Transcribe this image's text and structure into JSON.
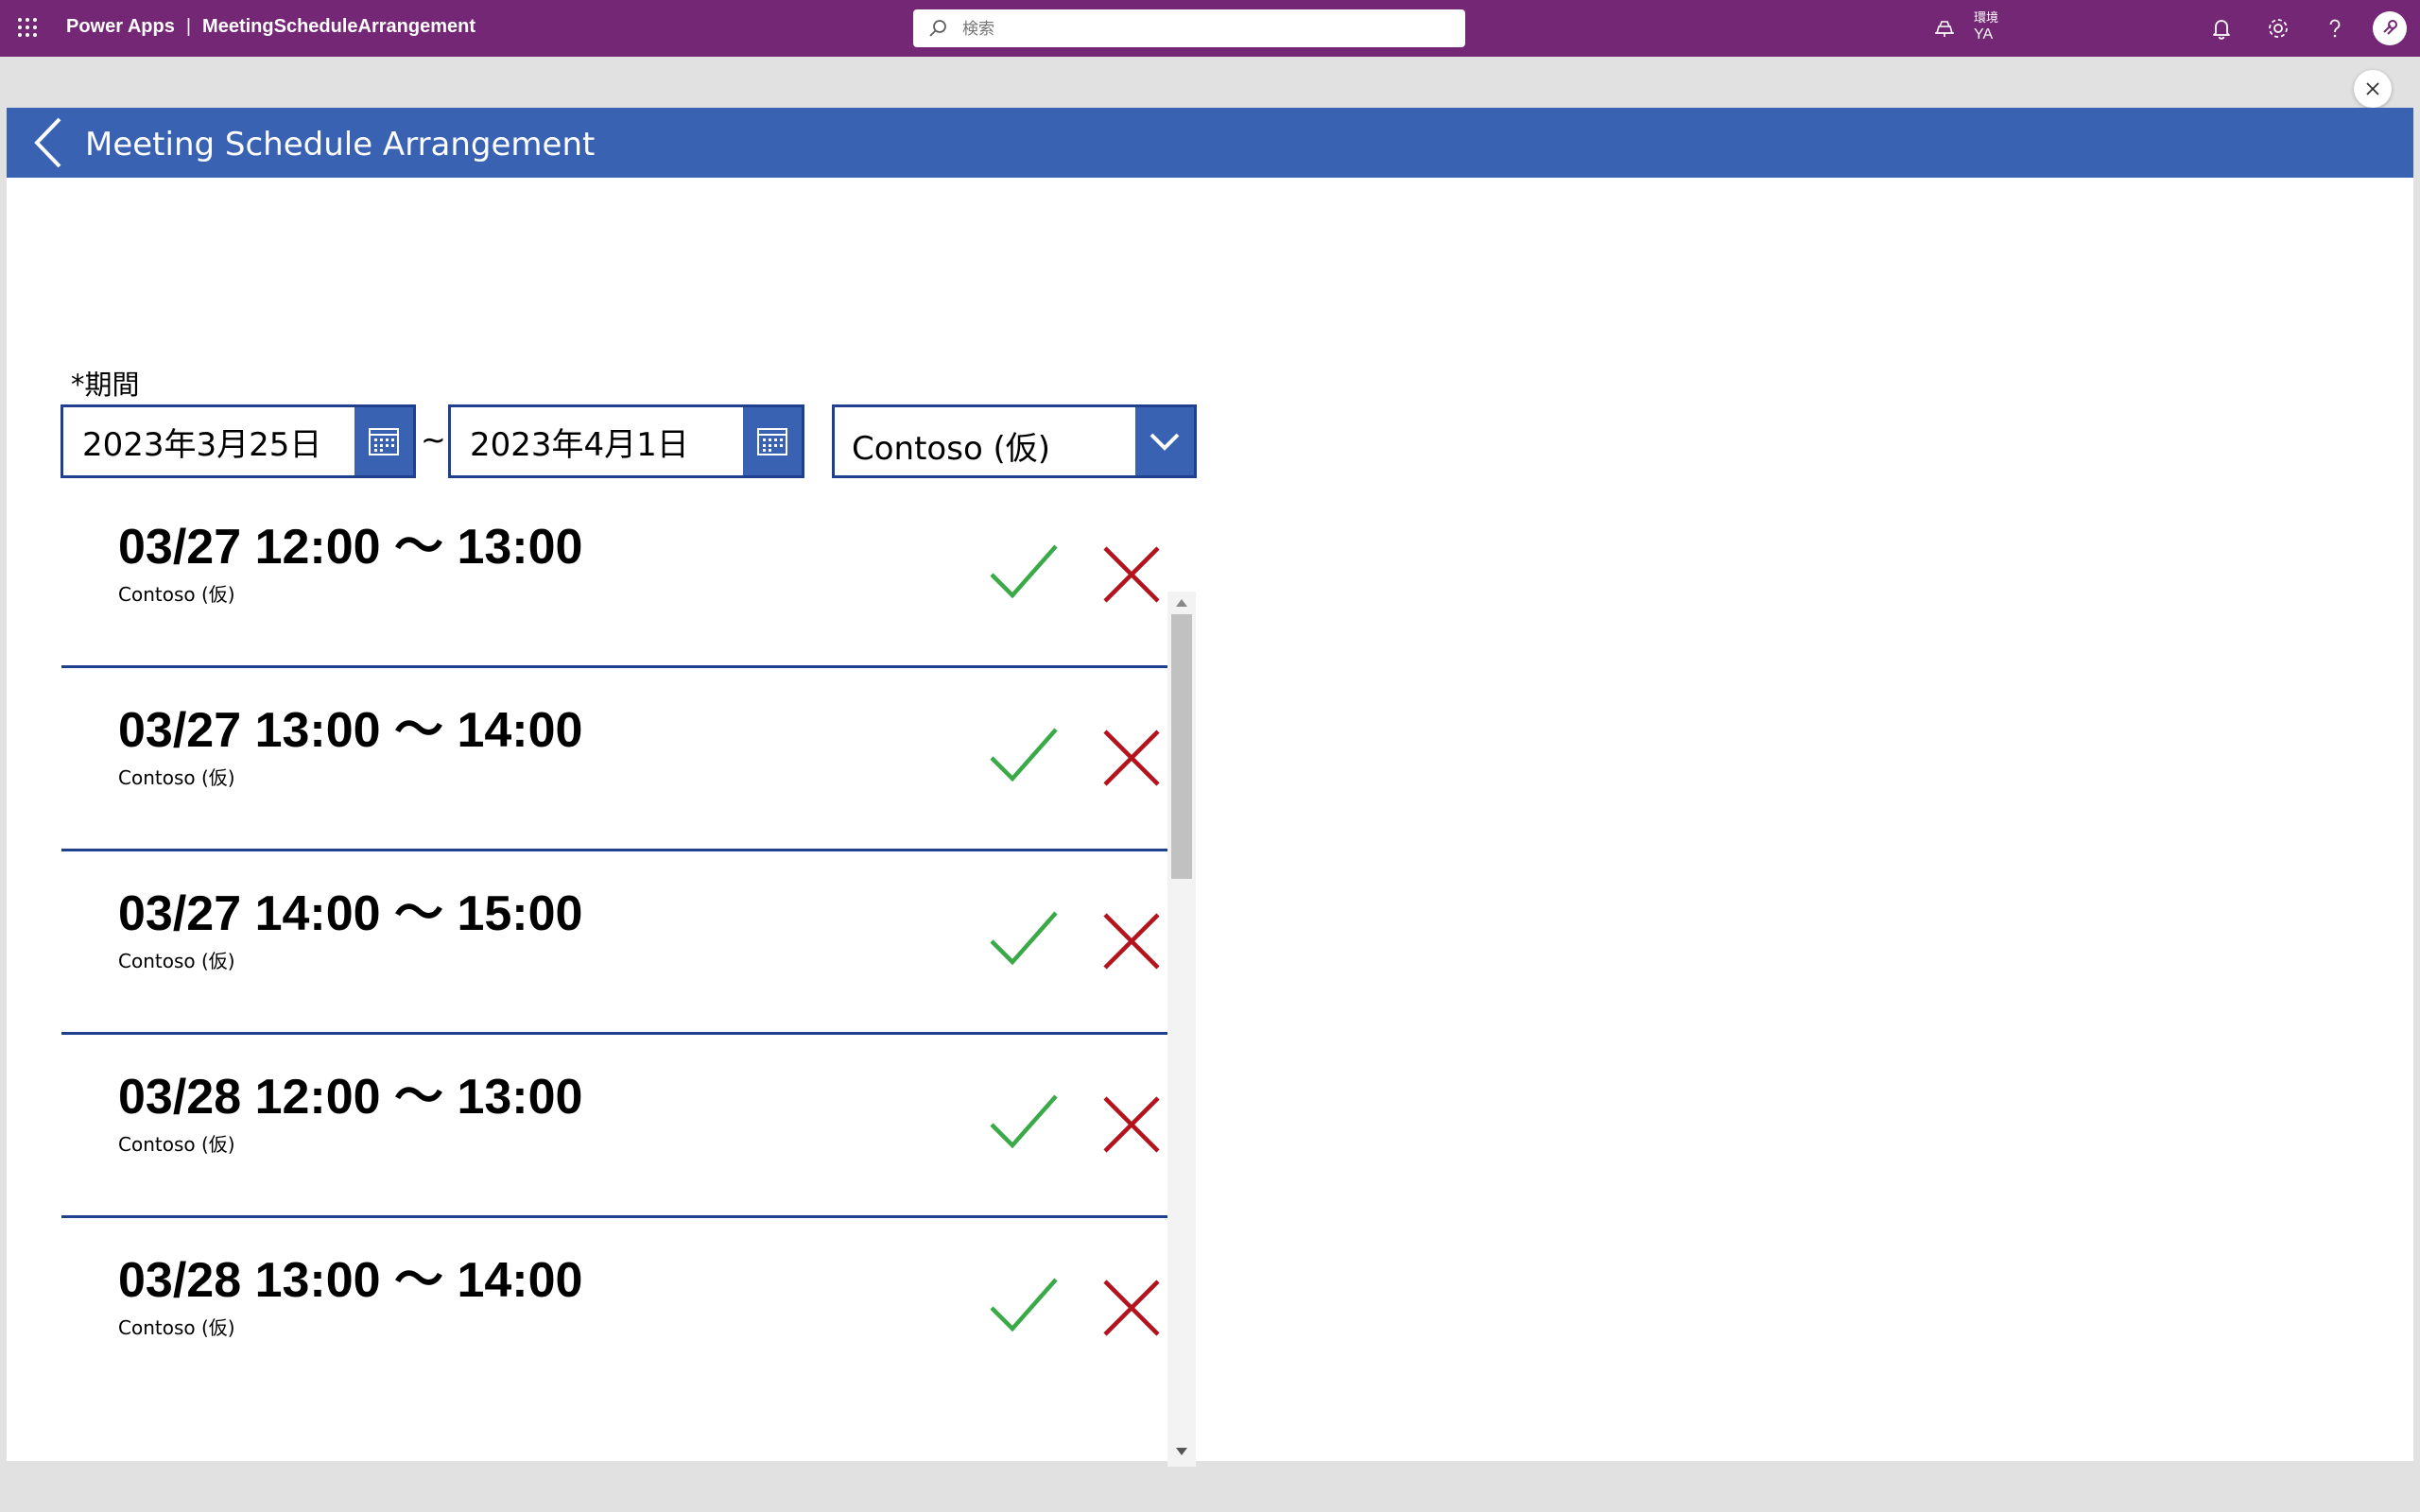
{
  "topbar": {
    "product": "Power Apps",
    "separator": "|",
    "app_name": "MeetingScheduleArrangement",
    "search_placeholder": "検索",
    "environment_label": "環境",
    "environment_name": "YA",
    "icons": [
      "waffle-icon",
      "search-icon",
      "environment-icon",
      "bell-icon",
      "gear-icon",
      "help-icon",
      "avatar-icon"
    ],
    "background_color": "#742774"
  },
  "app": {
    "title": "Meeting Schedule Arrangement",
    "header_color": "#3a62b3",
    "period_label": "*期間",
    "start_date": "2023年3月25日",
    "range_separator": "~",
    "end_date": "2023年4月1日",
    "company_filter": "Contoso (仮)"
  },
  "slots": [
    {
      "time": "03/27 12:00 〜 13:00",
      "org": "Contoso (仮)"
    },
    {
      "time": "03/27 13:00 〜 14:00",
      "org": "Contoso (仮)"
    },
    {
      "time": "03/27 14:00 〜 15:00",
      "org": "Contoso (仮)"
    },
    {
      "time": "03/28 12:00 〜 13:00",
      "org": "Contoso (仮)"
    },
    {
      "time": "03/28 13:00 〜 14:00",
      "org": "Contoso (仮)"
    }
  ],
  "colors": {
    "accept": "#3aaa49",
    "reject": "#b5121b",
    "divider": "#1f3f8f"
  }
}
